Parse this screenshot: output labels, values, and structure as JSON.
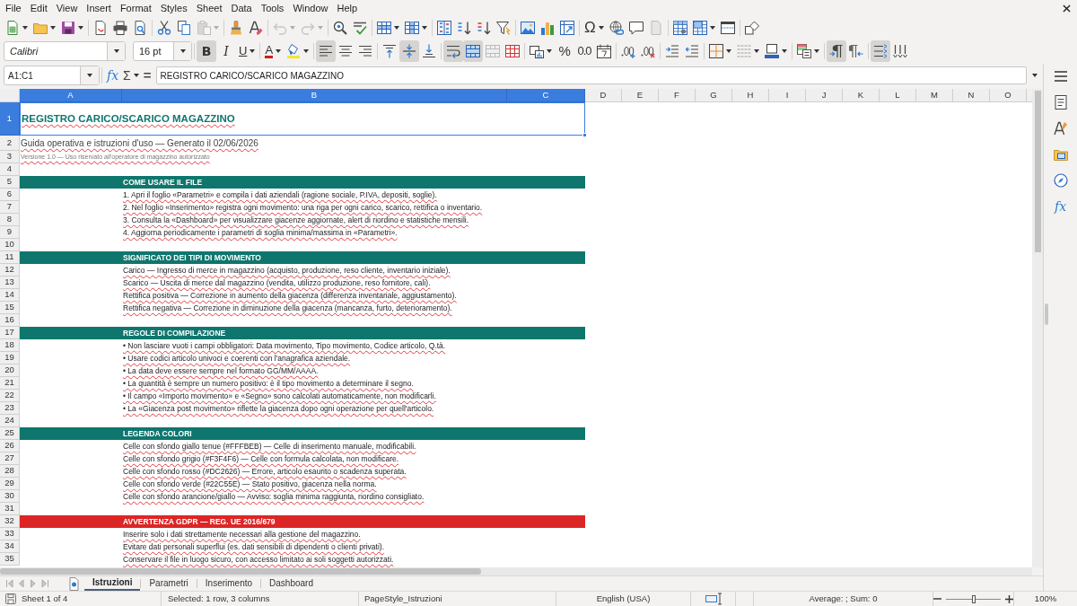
{
  "menu_bar": [
    "File",
    "Edit",
    "View",
    "Insert",
    "Format",
    "Styles",
    "Sheet",
    "Data",
    "Tools",
    "Window",
    "Help"
  ],
  "standard_toolbar": {
    "paste": {
      "disabled": true
    },
    "undo": {
      "disabled": true
    },
    "redo": {
      "disabled": true
    },
    "special_character": {
      "label": "Ω"
    }
  },
  "formatting_toolbar": {
    "font_name": "Calibri",
    "font_size": "16 pt",
    "bold": {
      "label": "B",
      "on": true
    },
    "italic": {
      "label": "I",
      "on": false
    },
    "underline": {
      "label": "U",
      "on": false
    },
    "font_color": {
      "label": "A"
    },
    "align_left": {
      "on": true
    },
    "align_center": {
      "on": false
    },
    "align_right": {
      "on": false
    },
    "align_top": {
      "on": false
    },
    "center_vertically": {
      "on": true
    },
    "align_bottom": {
      "on": false
    },
    "wrap_text": {
      "on": true
    },
    "merge_and_center": {
      "on": true
    },
    "percent": {
      "label": "%"
    },
    "standard_format": {
      "label": "0.0"
    },
    "left_to_right": {
      "on": true
    },
    "right_to_left": {
      "on": false
    },
    "text_direction_horizontal": {
      "on": true
    },
    "text_direction_vertical": {
      "on": false
    }
  },
  "formula_bar": {
    "name_box": "A1:C1",
    "function_wizard": "fx",
    "sum": "Σ",
    "equals": "=",
    "content": "REGISTRO CARICO/SCARICO MAGAZZINO"
  },
  "sheet": {
    "columns": [
      {
        "label": "A",
        "selected": true
      },
      {
        "label": "B",
        "selected": true
      },
      {
        "label": "C",
        "selected": true
      },
      {
        "label": "D",
        "selected": false
      },
      {
        "label": "E",
        "selected": false
      },
      {
        "label": "F",
        "selected": false
      },
      {
        "label": "G",
        "selected": false
      },
      {
        "label": "H",
        "selected": false
      },
      {
        "label": "I",
        "selected": false
      },
      {
        "label": "J",
        "selected": false
      },
      {
        "label": "K",
        "selected": false
      },
      {
        "label": "L",
        "selected": false
      },
      {
        "label": "M",
        "selected": false
      },
      {
        "label": "N",
        "selected": false
      },
      {
        "label": "O",
        "selected": false
      }
    ],
    "rows": [
      {
        "number": "1",
        "selected": true,
        "kind": "title",
        "text": "REGISTRO CARICO/SCARICO MAGAZZINO"
      },
      {
        "number": "2",
        "selected": false,
        "kind": "subtitle",
        "text": "Guida operativa e istruzioni d'uso — Generato il 02/06/2026"
      },
      {
        "number": "3",
        "selected": false,
        "kind": "note",
        "text": "Versione 1.0 — Uso riservato all'operatore di magazzino autorizzato"
      },
      {
        "number": "4",
        "selected": false,
        "kind": "blank"
      },
      {
        "number": "5",
        "selected": false,
        "kind": "section",
        "text": "COME USARE IL FILE",
        "color": "#0f766e"
      },
      {
        "number": "6",
        "selected": false,
        "kind": "text",
        "text": "1. Apri il foglio «Parametri» e compila i dati aziendali (ragione sociale, P.IVA, depositi, soglie)."
      },
      {
        "number": "7",
        "selected": false,
        "kind": "text",
        "text": "2. Nel foglio «Inserimento» registra ogni movimento: una riga per ogni carico, scarico, rettifica o inventario."
      },
      {
        "number": "8",
        "selected": false,
        "kind": "text",
        "text": "3. Consulta la «Dashboard» per visualizzare giacenze aggiornate, alert di riordino e statistiche mensili."
      },
      {
        "number": "9",
        "selected": false,
        "kind": "text",
        "text": "4. Aggiorna periodicamente i parametri di soglia minima/massima in «Parametri»."
      },
      {
        "number": "10",
        "selected": false,
        "kind": "blank"
      },
      {
        "number": "11",
        "selected": false,
        "kind": "section",
        "text": "SIGNIFICATO DEI TIPI DI MOVIMENTO",
        "color": "#0f766e"
      },
      {
        "number": "12",
        "selected": false,
        "kind": "text",
        "text": "Carico — Ingresso di merce in magazzino (acquisto, produzione, reso cliente, inventario iniziale)."
      },
      {
        "number": "13",
        "selected": false,
        "kind": "text",
        "text": "Scarico — Uscita di merce dal magazzino (vendita, utilizzo produzione, reso fornitore, cali)."
      },
      {
        "number": "14",
        "selected": false,
        "kind": "text",
        "text": "Rettifica positiva — Correzione in aumento della giacenza (differenza inventariale, aggiustamento)."
      },
      {
        "number": "15",
        "selected": false,
        "kind": "text",
        "text": "Rettifica negativa — Correzione in diminuzione della giacenza (mancanza, furto, deterioramento)."
      },
      {
        "number": "16",
        "selected": false,
        "kind": "blank"
      },
      {
        "number": "17",
        "selected": false,
        "kind": "section",
        "text": "REGOLE DI COMPILAZIONE",
        "color": "#0f766e"
      },
      {
        "number": "18",
        "selected": false,
        "kind": "text",
        "text": "• Non lasciare vuoti i campi obbligatori: Data movimento, Tipo movimento, Codice articolo, Q.tà."
      },
      {
        "number": "19",
        "selected": false,
        "kind": "text",
        "text": "• Usare codici articolo univoci e coerenti con l'anagrafica aziendale."
      },
      {
        "number": "20",
        "selected": false,
        "kind": "text",
        "text": "• La data deve essere sempre nel formato GG/MM/AAAA."
      },
      {
        "number": "21",
        "selected": false,
        "kind": "text",
        "text": "• La quantità è sempre un numero positivo: è il tipo movimento a determinare il segno."
      },
      {
        "number": "22",
        "selected": false,
        "kind": "text",
        "text": "• Il campo «Importo movimento» e «Segno» sono calcolati automaticamente, non modificarli."
      },
      {
        "number": "23",
        "selected": false,
        "kind": "text",
        "text": "• La «Giacenza post movimento» riflette la giacenza dopo ogni operazione per quell'articolo."
      },
      {
        "number": "24",
        "selected": false,
        "kind": "blank"
      },
      {
        "number": "25",
        "selected": false,
        "kind": "section",
        "text": "LEGENDA COLORI",
        "color": "#0f766e"
      },
      {
        "number": "26",
        "selected": false,
        "kind": "text",
        "text": "Celle con sfondo giallo tenue (#FFFBEB) — Celle di inserimento manuale, modificabili."
      },
      {
        "number": "27",
        "selected": false,
        "kind": "text",
        "text": "Celle con sfondo grigio (#F3F4F6) — Celle con formula calcolata, non modificare."
      },
      {
        "number": "28",
        "selected": false,
        "kind": "text",
        "text": "Celle con sfondo rosso (#DC2626) — Errore, articolo esaurito o scadenza superata."
      },
      {
        "number": "29",
        "selected": false,
        "kind": "text",
        "text": "Celle con sfondo verde (#22C55E) — Stato positivo, giacenza nella norma."
      },
      {
        "number": "30",
        "selected": false,
        "kind": "text",
        "text": "Celle con sfondo arancione/giallo — Avviso: soglia minima raggiunta, riordino consigliato."
      },
      {
        "number": "31",
        "selected": false,
        "kind": "blank"
      },
      {
        "number": "32",
        "selected": false,
        "kind": "section",
        "text": "AVVERTENZA GDPR — REG. UE 2016/679",
        "color": "#dc2626"
      },
      {
        "number": "33",
        "selected": false,
        "kind": "text",
        "text": "Inserire solo i dati strettamente necessari alla gestione del magazzino."
      },
      {
        "number": "34",
        "selected": false,
        "kind": "text",
        "text": "Evitare dati personali superflui (es. dati sensibili di dipendenti o clienti privati)."
      },
      {
        "number": "35",
        "selected": false,
        "kind": "text",
        "text": "Conservare il file in luogo sicuro, con accesso limitato ai soli soggetti autorizzati."
      }
    ]
  },
  "sheet_tabs": [
    {
      "label": "Istruzioni",
      "selected": true
    },
    {
      "label": "Parametri",
      "selected": false
    },
    {
      "label": "Inserimento",
      "selected": false
    },
    {
      "label": "Dashboard",
      "selected": false
    }
  ],
  "sidebar": {
    "functions": "fx"
  },
  "status_bar": {
    "sheet": "Sheet 1 of 4",
    "selection": "Selected: 1 row, 3 columns",
    "page_style": "PageStyle_Istruzioni",
    "language": "English (USA)",
    "statistics": "Average: ; Sum: 0",
    "zoom": {
      "level": 0.5,
      "reading": "100%"
    }
  }
}
